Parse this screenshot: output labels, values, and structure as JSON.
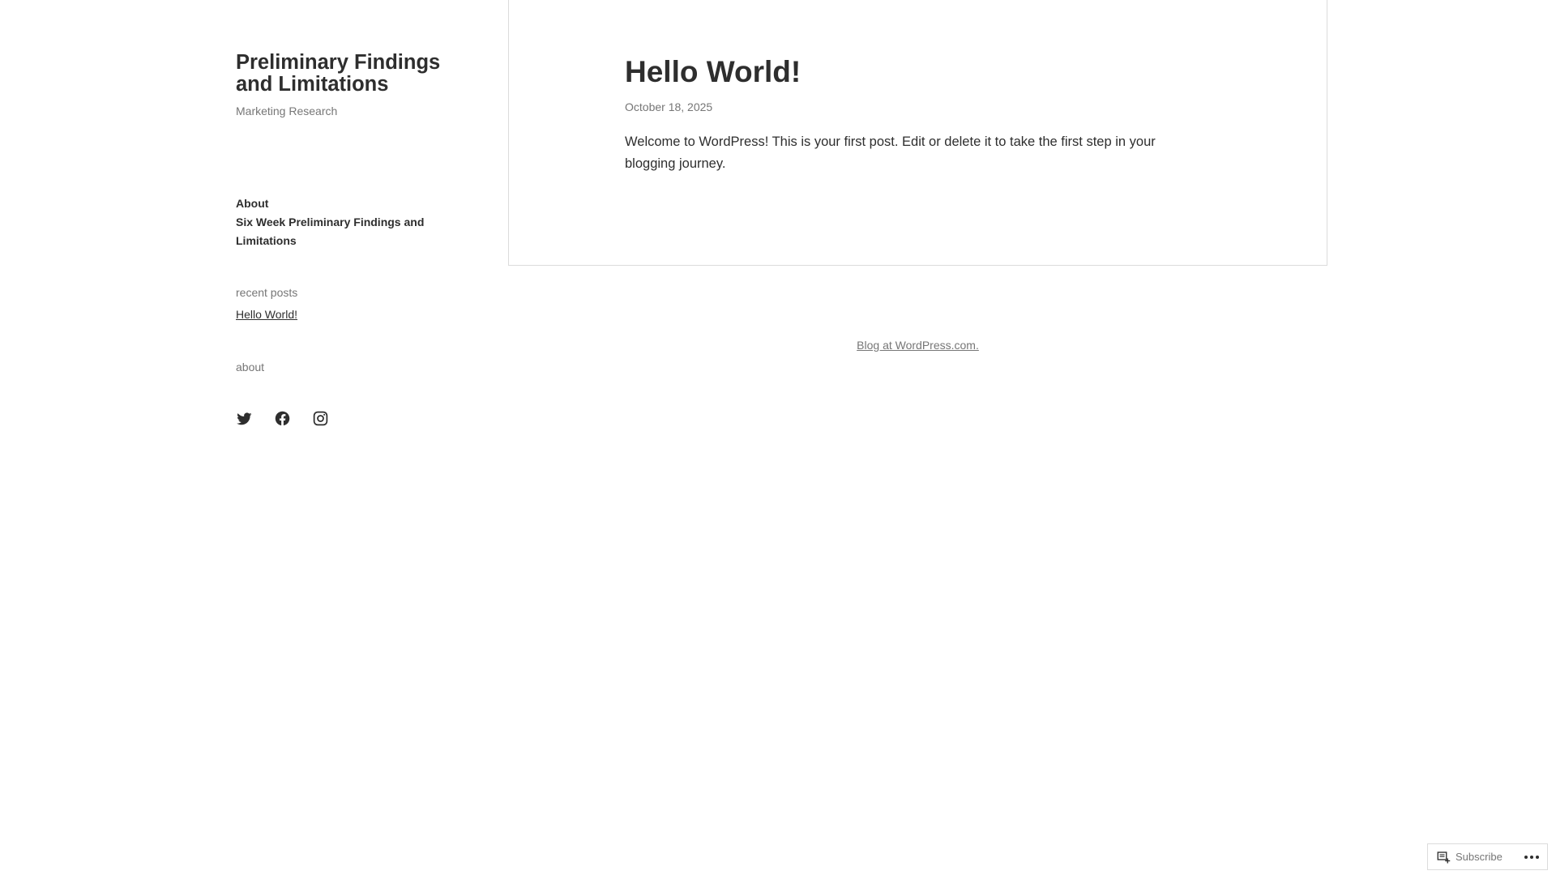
{
  "site": {
    "title": "Preliminary Findings and Limitations",
    "tagline": "Marketing Research"
  },
  "nav": {
    "items": [
      {
        "label": "About"
      },
      {
        "label": "Six Week Preliminary Findings and Limitations"
      }
    ]
  },
  "widgets": {
    "recent_posts": {
      "title": "recent posts",
      "items": [
        {
          "label": "Hello World!"
        }
      ]
    },
    "about": {
      "title": "about"
    }
  },
  "social": {
    "icons": [
      "twitter-icon",
      "facebook-icon",
      "instagram-icon"
    ]
  },
  "post": {
    "title": "Hello World!",
    "date": "October 18, 2025",
    "body": "Welcome to WordPress! This is your first post. Edit or delete it to take the first step in your blogging journey."
  },
  "footer": {
    "credit": "Blog at WordPress.com."
  },
  "action_bar": {
    "subscribe_label": "Subscribe"
  },
  "colors": {
    "text": "#2e2e2e",
    "muted": "#767676",
    "border": "#dcdcdc"
  }
}
